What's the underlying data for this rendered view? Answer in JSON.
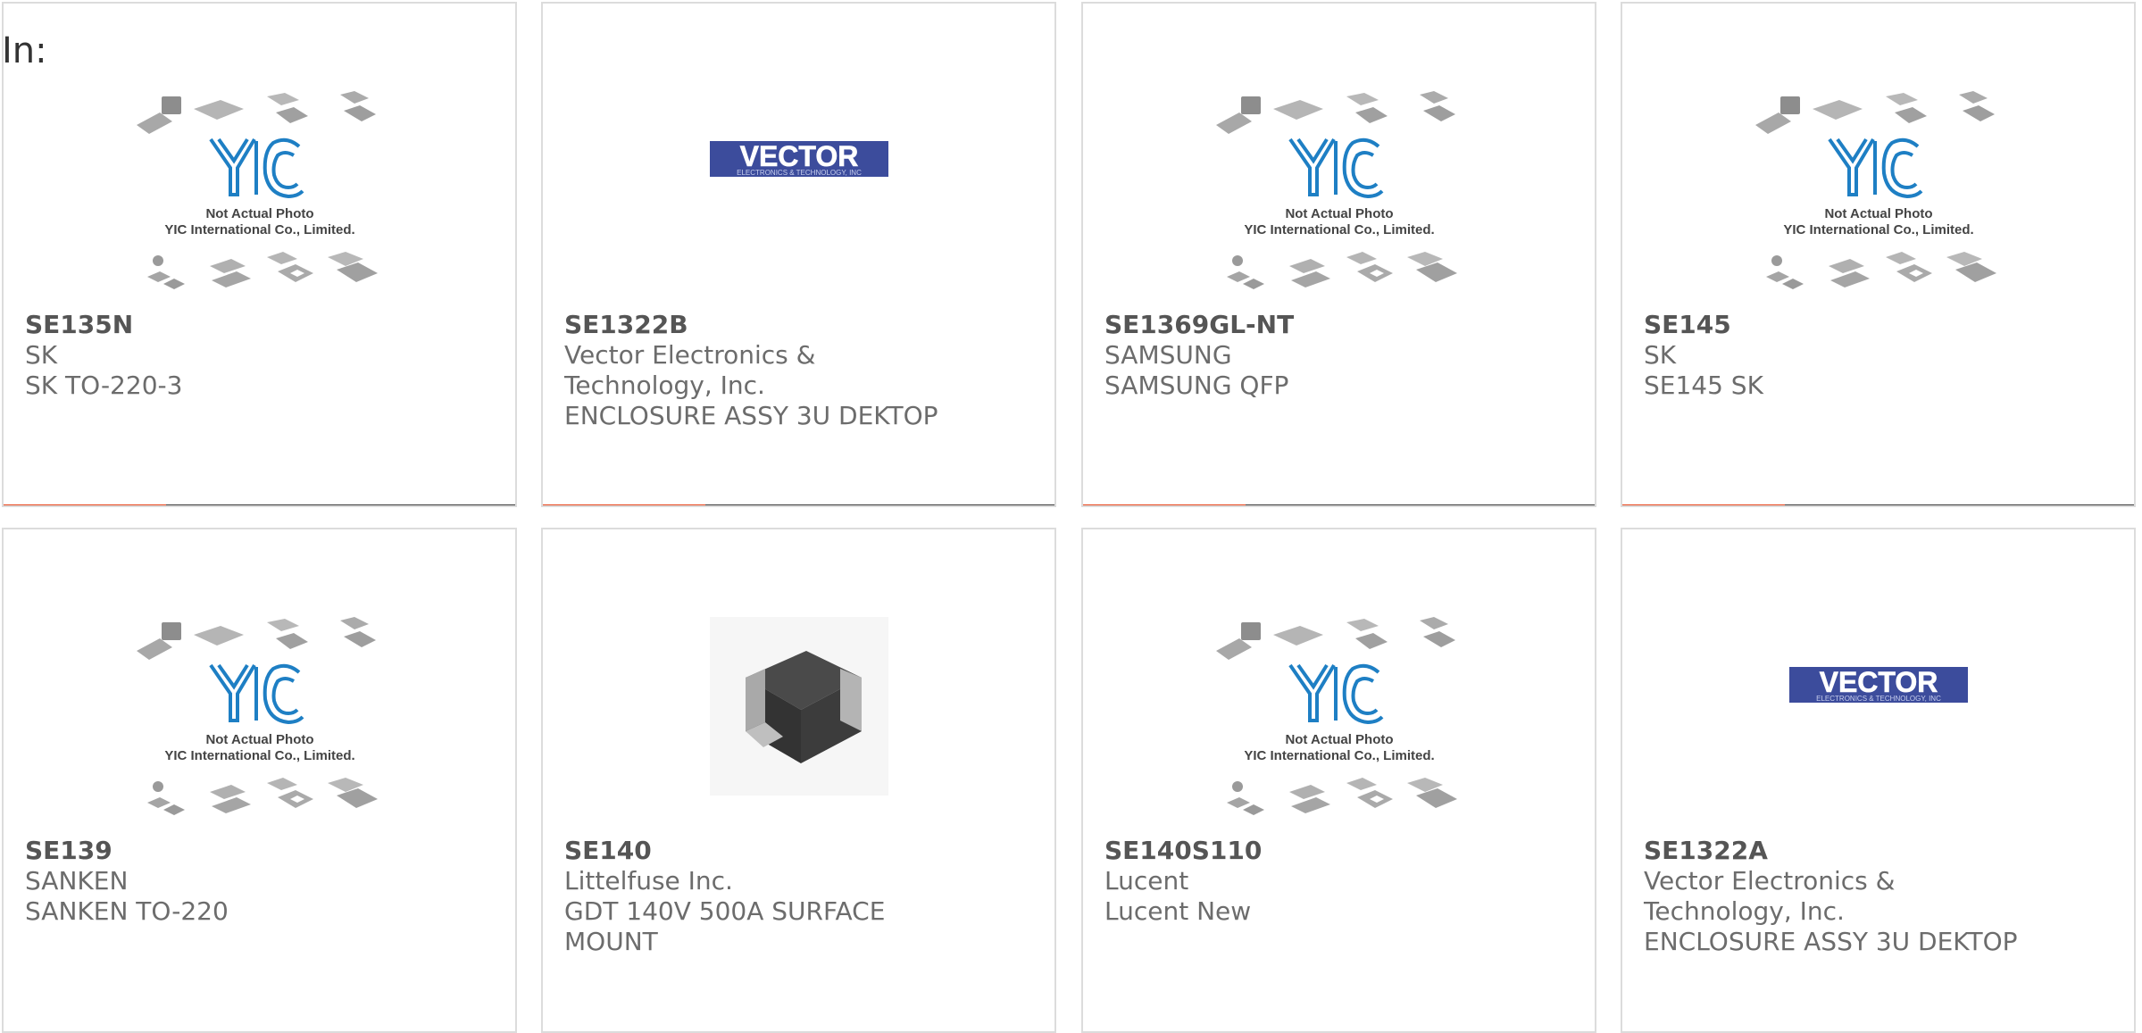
{
  "page": {
    "prefix_label": "In:"
  },
  "colors": {
    "accent": "#e8441a",
    "bar_dark": "#3d3d3d",
    "text_gray": "#6c6c6c",
    "yic_blue": "#1e7fc4",
    "vector_blue": "#3c4c9c"
  },
  "placeholder": {
    "line1": "Not Actual Photo",
    "line2": "YIC International Co., Limited."
  },
  "vector_logo": {
    "word": "VECTOR",
    "tagline": "ELECTRONICS & TECHNOLOGY, INC"
  },
  "products": [
    {
      "part": "SE135N",
      "manufacturer": "SK",
      "description": "SK TO-220-3",
      "image": "yic-placeholder"
    },
    {
      "part": "SE1322B",
      "manufacturer": "Vector Electronics & Technology, Inc.",
      "description": "ENCLOSURE ASSY 3U DEKTOP",
      "image": "vector-logo"
    },
    {
      "part": "SE1369GL-NT",
      "manufacturer": "SAMSUNG",
      "description": "SAMSUNG QFP",
      "image": "yic-placeholder"
    },
    {
      "part": "SE145",
      "manufacturer": "SK",
      "description": "SE145 SK",
      "image": "yic-placeholder"
    },
    {
      "part": "SE139",
      "manufacturer": "SANKEN",
      "description": "SANKEN TO-220",
      "image": "yic-placeholder"
    },
    {
      "part": "SE140",
      "manufacturer": "Littelfuse Inc.",
      "description": "GDT 140V 500A SURFACE MOUNT",
      "image": "component-photo"
    },
    {
      "part": "SE140S110",
      "manufacturer": "Lucent",
      "description": "Lucent New",
      "image": "yic-placeholder"
    },
    {
      "part": "SE1322A",
      "manufacturer": "Vector Electronics & Technology, Inc.",
      "description": "ENCLOSURE ASSY 3U DEKTOP",
      "image": "vector-logo"
    }
  ]
}
